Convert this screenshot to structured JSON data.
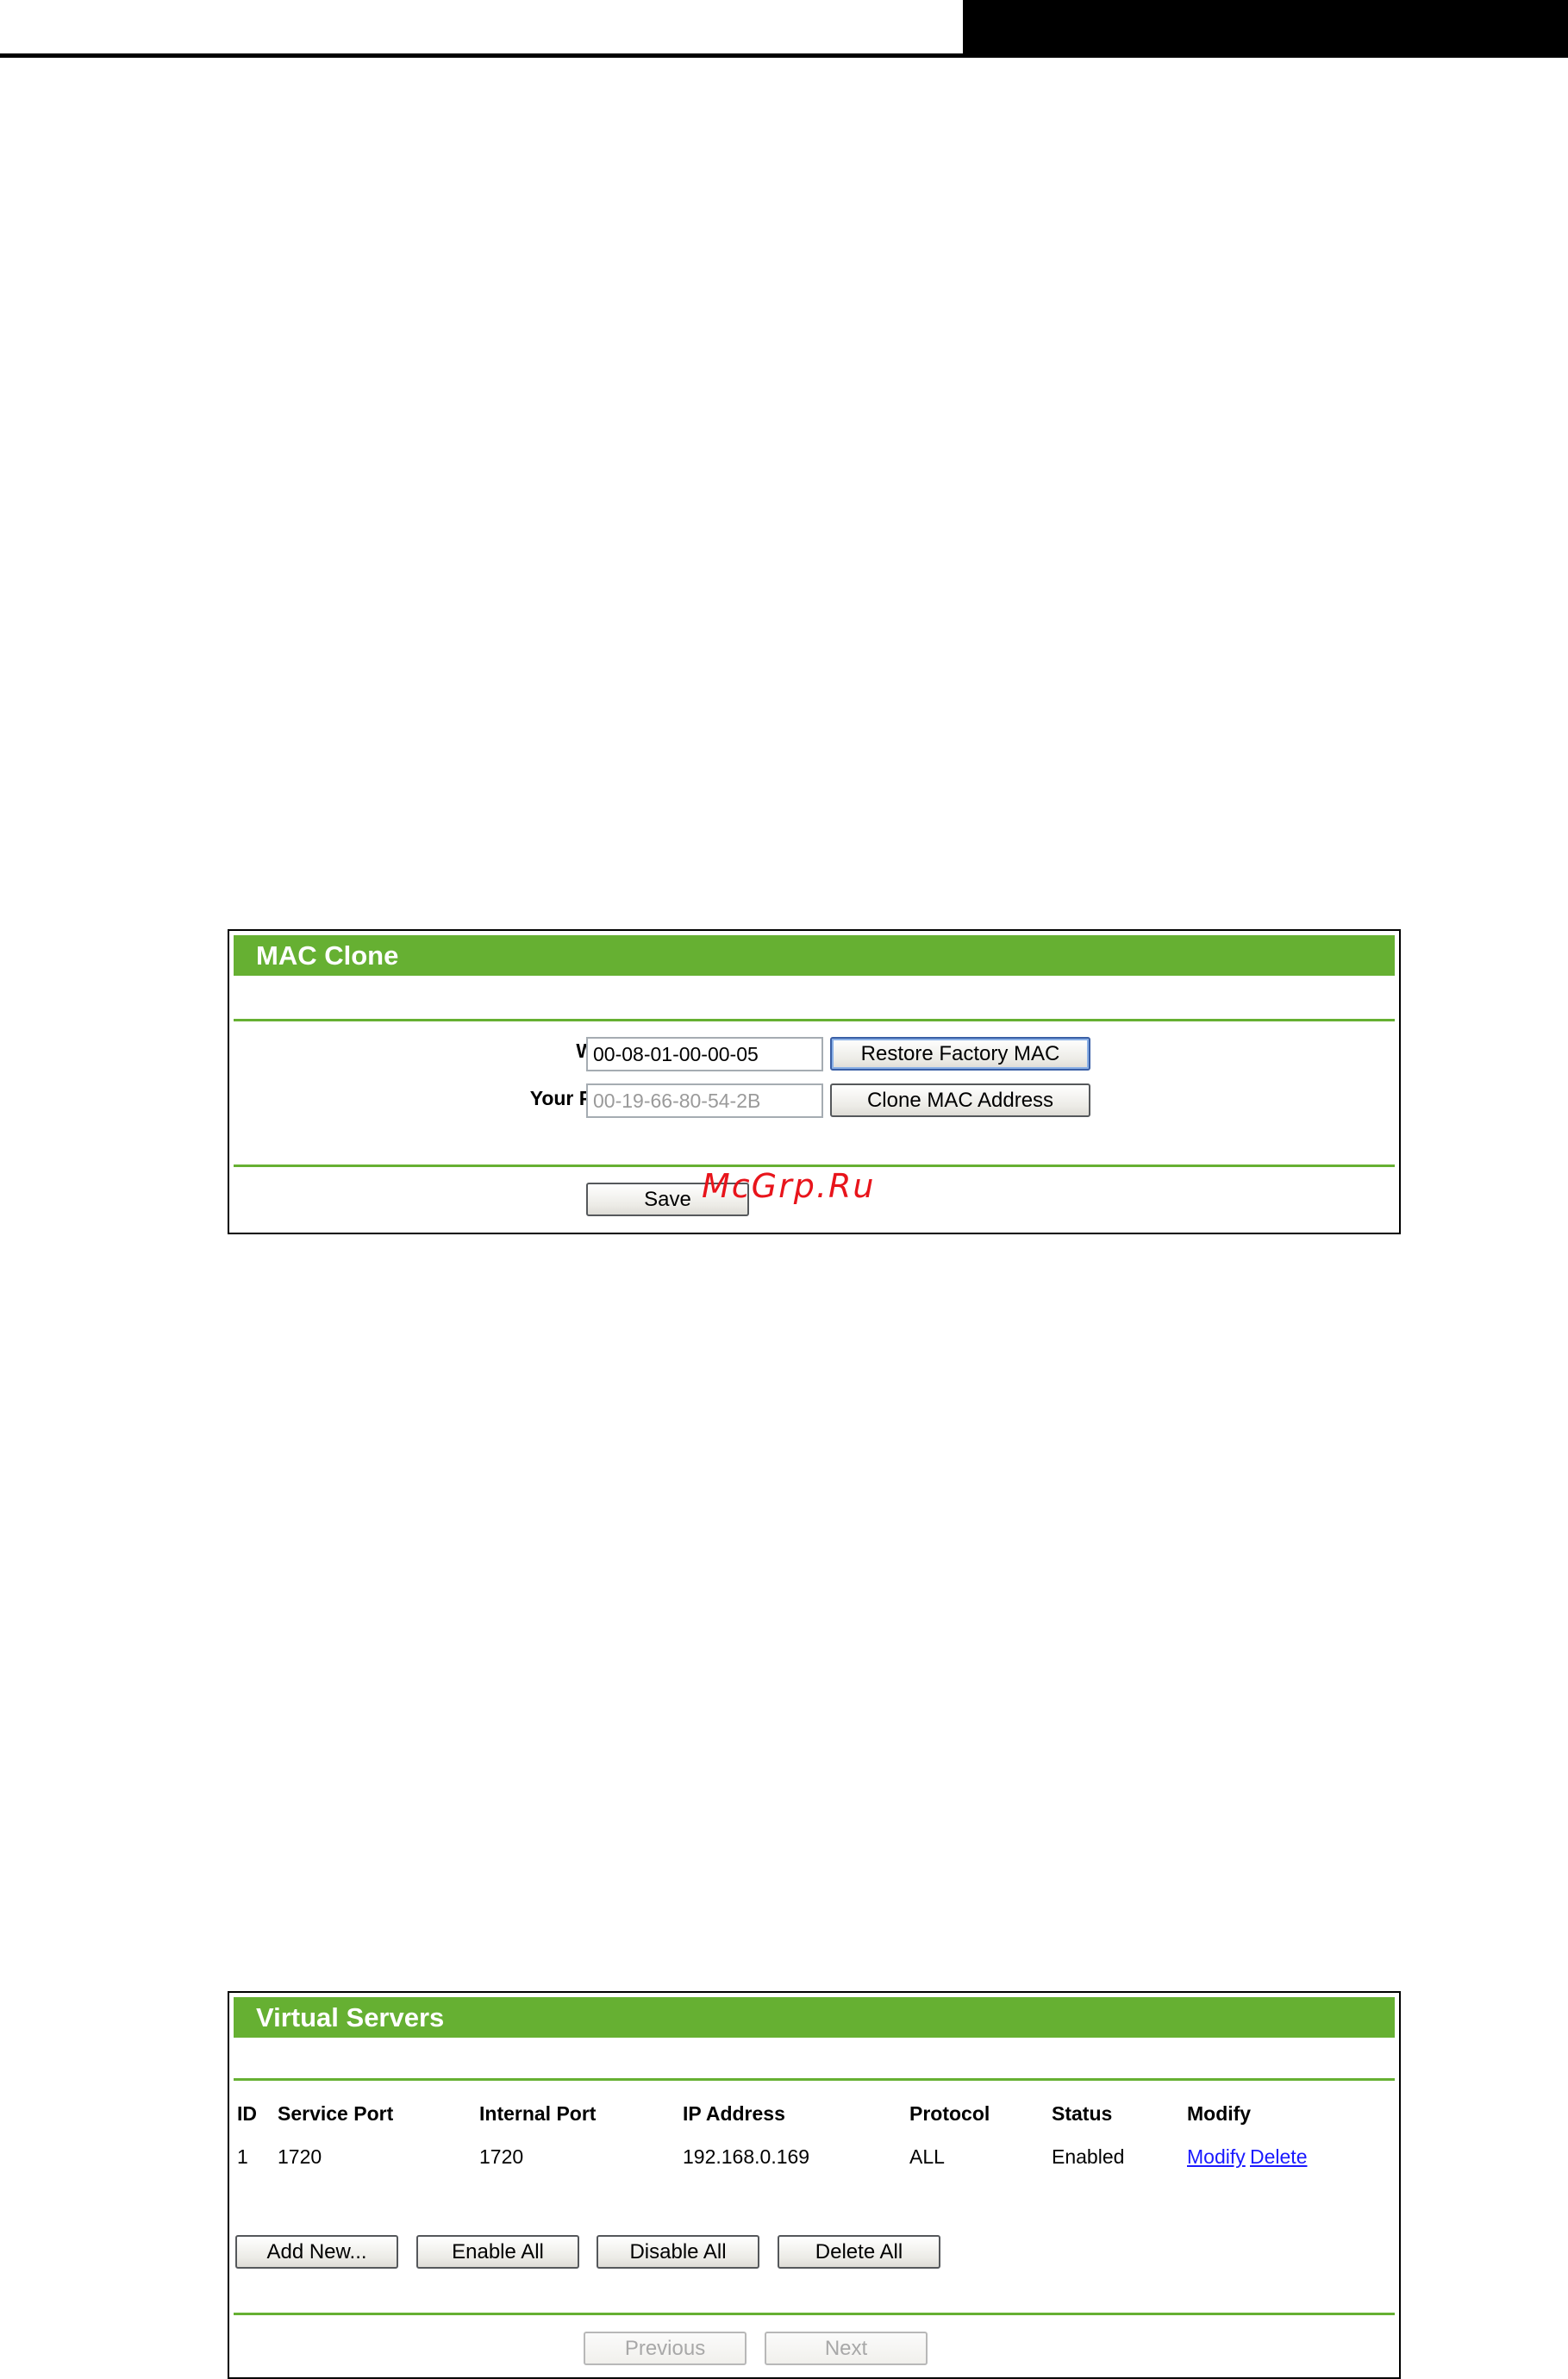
{
  "mac_clone": {
    "title": "MAC Clone",
    "wan_label": "WAN MAC Address:",
    "wan_value": "00-08-01-00-00-05",
    "restore_button": "Restore Factory MAC",
    "pc_label": "Your PC's MAC Address:",
    "pc_value": "00-19-66-80-54-2B",
    "clone_button": "Clone MAC Address",
    "save_button": "Save"
  },
  "watermark": "McGrp.Ru",
  "virtual_servers": {
    "title": "Virtual Servers",
    "headers": {
      "id": "ID",
      "service_port": "Service Port",
      "internal_port": "Internal Port",
      "ip_address": "IP Address",
      "protocol": "Protocol",
      "status": "Status",
      "modify": "Modify"
    },
    "rows": [
      {
        "id": "1",
        "service_port": "1720",
        "internal_port": "1720",
        "ip_address": "192.168.0.169",
        "protocol": "ALL",
        "status": "Enabled",
        "modify_link": "Modify",
        "delete_link": "Delete"
      }
    ],
    "buttons": {
      "add_new": "Add New...",
      "enable_all": "Enable All",
      "disable_all": "Disable All",
      "delete_all": "Delete All",
      "previous": "Previous",
      "next": "Next"
    }
  },
  "colors": {
    "panel_green": "#66b032",
    "link_blue": "#1a1aff",
    "watermark_red": "#e8141b"
  }
}
